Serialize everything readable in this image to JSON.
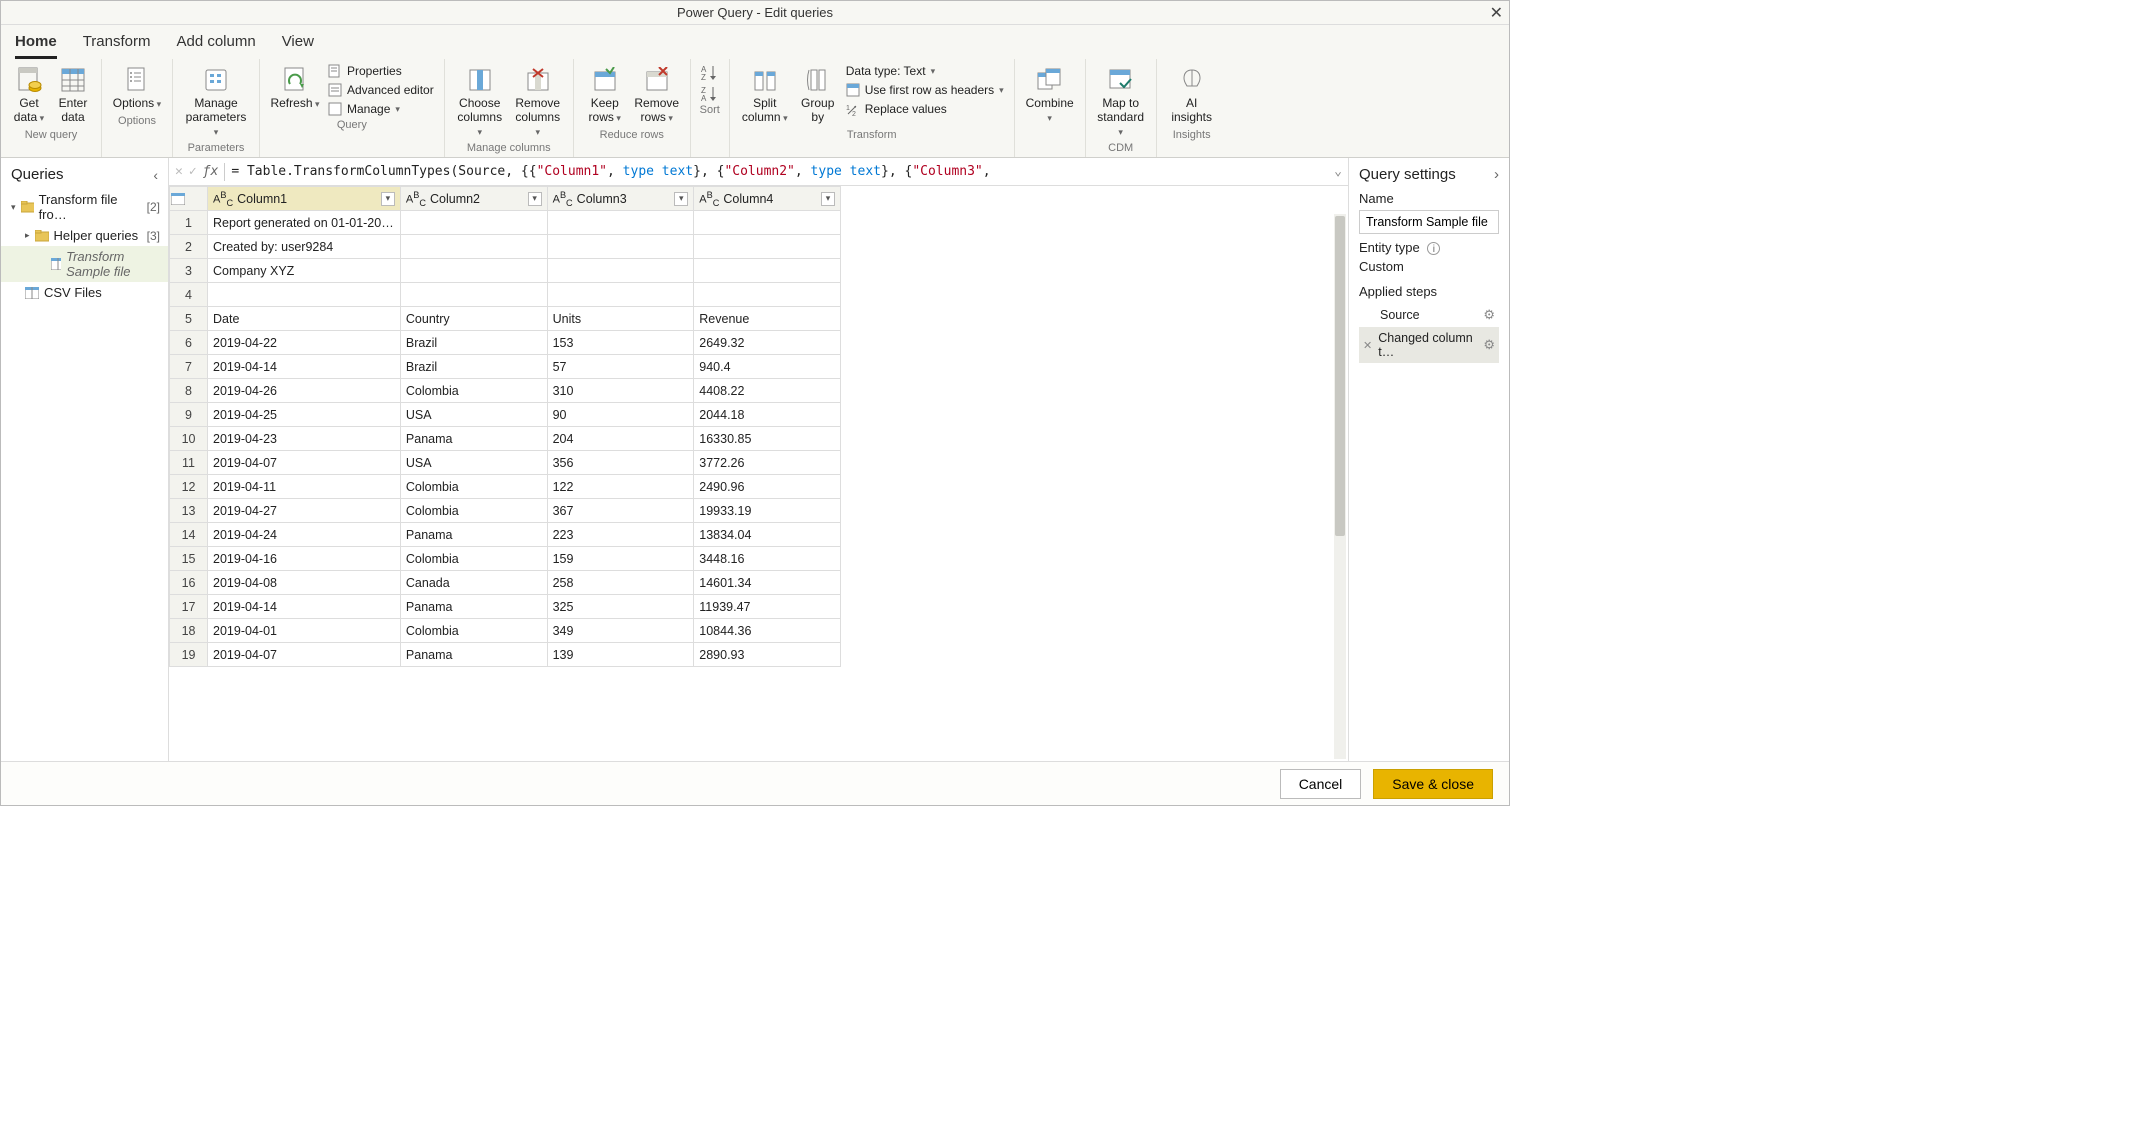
{
  "title": "Power Query - Edit queries",
  "tabs": [
    "Home",
    "Transform",
    "Add column",
    "View"
  ],
  "ribbon": {
    "new_query": {
      "get_data": "Get data",
      "enter_data": "Enter data",
      "label": "New query"
    },
    "options": {
      "options": "Options",
      "label": "Options"
    },
    "parameters": {
      "manage": "Manage parameters",
      "label": "Parameters"
    },
    "query": {
      "refresh": "Refresh",
      "properties": "Properties",
      "advanced": "Advanced editor",
      "manage": "Manage",
      "label": "Query"
    },
    "managecols": {
      "choose": "Choose columns",
      "remove": "Remove columns",
      "label": "Manage columns"
    },
    "reducerows": {
      "keep": "Keep rows",
      "remove": "Remove rows",
      "label": "Reduce rows"
    },
    "sort": {
      "label": "Sort"
    },
    "transform": {
      "split": "Split column",
      "groupby": "Group by",
      "datatype": "Data type: Text",
      "firstrow": "Use first row as headers",
      "replace": "Replace values",
      "label": "Transform"
    },
    "combine": {
      "combine": "Combine",
      "label": ""
    },
    "cdm": {
      "map": "Map to standard",
      "label": "CDM"
    },
    "insights": {
      "ai": "AI insights",
      "label": "Insights"
    }
  },
  "queries": {
    "heading": "Queries",
    "items": [
      {
        "label": "Transform file fro…",
        "count": "[2]",
        "icon": "folder",
        "expand": "down",
        "indent": 0
      },
      {
        "label": "Helper queries",
        "count": "[3]",
        "icon": "folder",
        "expand": "right",
        "indent": 1
      },
      {
        "label": "Transform Sample file",
        "count": "",
        "icon": "table",
        "indent": 2,
        "selected": true,
        "italic": true
      },
      {
        "label": "CSV Files",
        "count": "",
        "icon": "table",
        "indent": 0
      }
    ]
  },
  "formula": {
    "prefix": "= ",
    "fn": "Table.TransformColumnTypes",
    "parts": [
      "(Source, {{",
      {
        "str": "\"Column1\""
      },
      ", ",
      {
        "kw": "type text"
      },
      "}, {",
      {
        "str": "\"Column2\""
      },
      ", ",
      {
        "kw": "type text"
      },
      "}, {",
      {
        "str": "\"Column3\""
      },
      ","
    ]
  },
  "columns": [
    "Column1",
    "Column2",
    "Column3",
    "Column4"
  ],
  "rows": [
    [
      "Report generated on 01-01-20…",
      "",
      "",
      ""
    ],
    [
      "Created by: user9284",
      "",
      "",
      ""
    ],
    [
      "Company XYZ",
      "",
      "",
      ""
    ],
    [
      "",
      "",
      "",
      ""
    ],
    [
      "Date",
      "Country",
      "Units",
      "Revenue"
    ],
    [
      "2019-04-22",
      "Brazil",
      "153",
      "2649.32"
    ],
    [
      "2019-04-14",
      "Brazil",
      "57",
      "940.4"
    ],
    [
      "2019-04-26",
      "Colombia",
      "310",
      "4408.22"
    ],
    [
      "2019-04-25",
      "USA",
      "90",
      "2044.18"
    ],
    [
      "2019-04-23",
      "Panama",
      "204",
      "16330.85"
    ],
    [
      "2019-04-07",
      "USA",
      "356",
      "3772.26"
    ],
    [
      "2019-04-11",
      "Colombia",
      "122",
      "2490.96"
    ],
    [
      "2019-04-27",
      "Colombia",
      "367",
      "19933.19"
    ],
    [
      "2019-04-24",
      "Panama",
      "223",
      "13834.04"
    ],
    [
      "2019-04-16",
      "Colombia",
      "159",
      "3448.16"
    ],
    [
      "2019-04-08",
      "Canada",
      "258",
      "14601.34"
    ],
    [
      "2019-04-14",
      "Panama",
      "325",
      "11939.47"
    ],
    [
      "2019-04-01",
      "Colombia",
      "349",
      "10844.36"
    ],
    [
      "2019-04-07",
      "Panama",
      "139",
      "2890.93"
    ]
  ],
  "settings": {
    "heading": "Query settings",
    "name_label": "Name",
    "name_value": "Transform Sample file",
    "entity_label": "Entity type",
    "entity_value": "Custom",
    "steps_label": "Applied steps",
    "steps": [
      {
        "label": "Source",
        "gear": true
      },
      {
        "label": "Changed column t…",
        "gear": true,
        "del": true,
        "selected": true
      }
    ]
  },
  "footer": {
    "cancel": "Cancel",
    "save": "Save & close"
  }
}
